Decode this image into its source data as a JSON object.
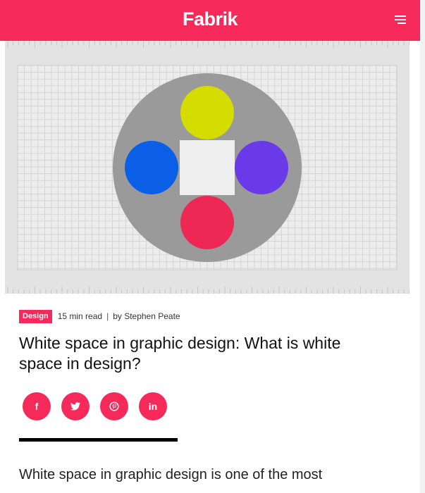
{
  "header": {
    "logo_text": "Fabrik",
    "menu_icon": "hamburger-menu-icon",
    "background_color": "#f52a5a"
  },
  "hero": {
    "description_colors": {
      "outer_circle": "#9a9a9a",
      "top_dot": "#d4dc00",
      "left_dot": "#0a5fe6",
      "right_dot": "#6a3ae8",
      "bottom_dot": "#ee2855",
      "center_square": "#eeeeee",
      "grid_background": "#e3e3e3"
    }
  },
  "article": {
    "category": "Design",
    "read_time": "15 min read",
    "separator": "|",
    "byline": "by Stephen Peate",
    "title": "White space in graphic design: What is white space in design?",
    "intro": "White space in graphic design is one of the most"
  },
  "share": {
    "buttons": [
      {
        "network": "facebook",
        "icon": "facebook-icon",
        "glyph": "f"
      },
      {
        "network": "twitter",
        "icon": "twitter-icon"
      },
      {
        "network": "pinterest",
        "icon": "pinterest-icon"
      },
      {
        "network": "linkedin",
        "icon": "linkedin-icon",
        "glyph": "in"
      }
    ]
  }
}
